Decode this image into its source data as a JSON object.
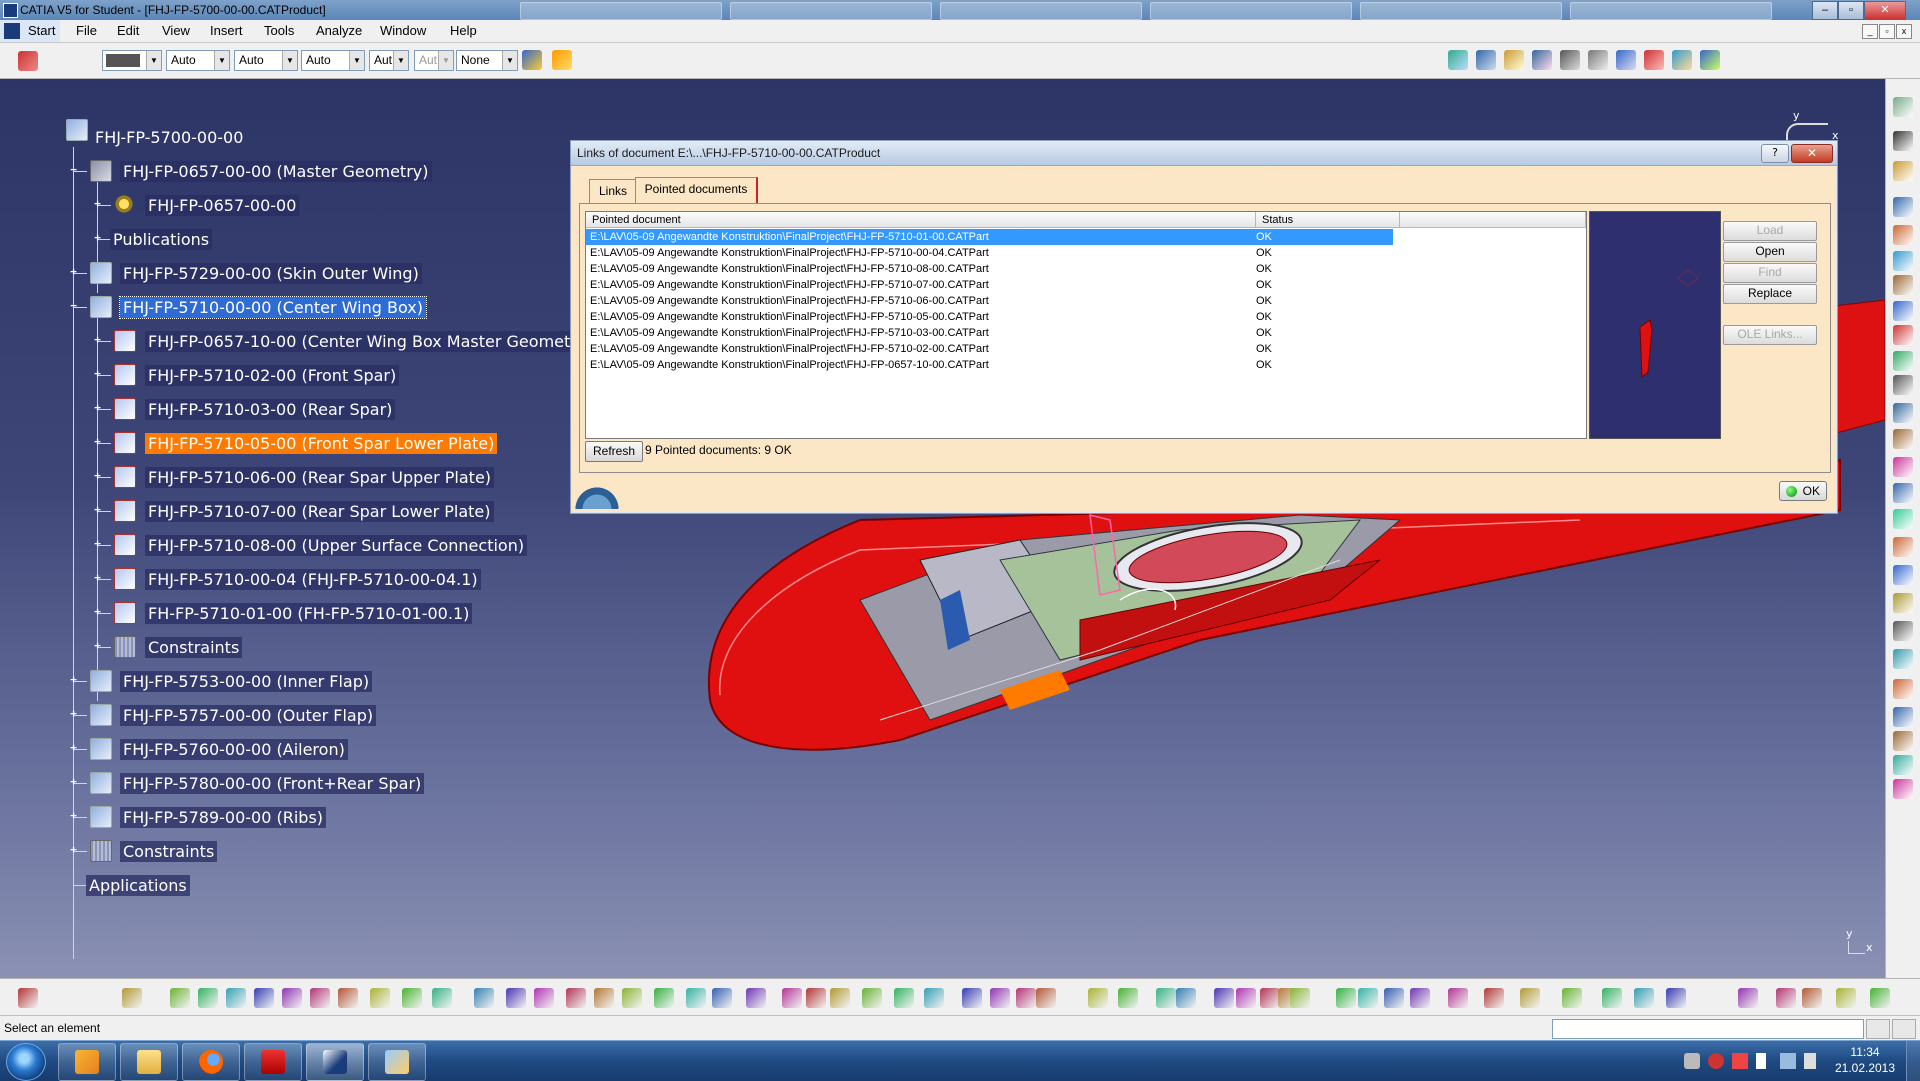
{
  "window": {
    "title": "CATIA V5 for Student - [FHJ-FP-5700-00-00.CATProduct]",
    "minimize": "–",
    "maximize": "▫",
    "close": "✕"
  },
  "menu": {
    "start": "Start",
    "items": [
      "File",
      "Edit",
      "View",
      "Insert",
      "Tools",
      "Analyze",
      "Window",
      "Help"
    ]
  },
  "toolbar": {
    "combos": [
      {
        "value": "",
        "disabled": false
      },
      {
        "value": "Auto",
        "disabled": false
      },
      {
        "value": "Auto",
        "disabled": false
      },
      {
        "value": "Auto",
        "disabled": false
      },
      {
        "value": "Aut",
        "disabled": false
      },
      {
        "value": "Aut",
        "disabled": true
      },
      {
        "value": "None",
        "disabled": false
      }
    ]
  },
  "tree": {
    "root": "FHJ-FP-5700-00-00",
    "nodes": [
      {
        "label": "FHJ-FP-0657-00-00 (Master Geometry)",
        "level": 1,
        "expanded": true,
        "icon": "geometry-icon"
      },
      {
        "label": "FHJ-FP-0657-00-00",
        "level": 2,
        "expanded": false,
        "icon": "part-gear-icon"
      },
      {
        "label": "Publications",
        "level": 2,
        "expanded": false,
        "icon": "none"
      },
      {
        "label": "FHJ-FP-5729-00-00 (Skin Outer Wing)",
        "level": 1,
        "expanded": false,
        "icon": "product-icon"
      },
      {
        "label": "FHJ-FP-5710-00-00 (Center Wing Box)",
        "level": 1,
        "expanded": true,
        "icon": "product-icon",
        "state": "selected-blue"
      },
      {
        "label": "FHJ-FP-0657-10-00 (Center Wing Box Master Geometry)",
        "level": 2,
        "expanded": false,
        "icon": "part-icon"
      },
      {
        "label": "FHJ-FP-5710-02-00 (Front Spar)",
        "level": 2,
        "expanded": false,
        "icon": "part-icon"
      },
      {
        "label": "FHJ-FP-5710-03-00 (Rear Spar)",
        "level": 2,
        "expanded": false,
        "icon": "part-icon"
      },
      {
        "label": "FHJ-FP-5710-05-00 (Front Spar Lower Plate)",
        "level": 2,
        "expanded": false,
        "icon": "part-icon",
        "state": "selected-orange"
      },
      {
        "label": "FHJ-FP-5710-06-00 (Rear Spar Upper Plate)",
        "level": 2,
        "expanded": false,
        "icon": "part-icon"
      },
      {
        "label": "FHJ-FP-5710-07-00 (Rear Spar Lower Plate)",
        "level": 2,
        "expanded": false,
        "icon": "part-icon"
      },
      {
        "label": "FHJ-FP-5710-08-00 (Upper Surface Connection)",
        "level": 2,
        "expanded": false,
        "icon": "part-icon"
      },
      {
        "label": "FHJ-FP-5710-00-04 (FHJ-FP-5710-00-04.1)",
        "level": 2,
        "expanded": false,
        "icon": "part-icon"
      },
      {
        "label": "FH-FP-5710-01-00 (FH-FP-5710-01-00.1)",
        "level": 2,
        "expanded": false,
        "icon": "part-icon"
      },
      {
        "label": "Constraints",
        "level": 2,
        "expanded": false,
        "icon": "constraint-icon"
      },
      {
        "label": "FHJ-FP-5753-00-00 (Inner Flap)",
        "level": 1,
        "expanded": false,
        "icon": "product-icon"
      },
      {
        "label": "FHJ-FP-5757-00-00 (Outer Flap)",
        "level": 1,
        "expanded": false,
        "icon": "product-icon"
      },
      {
        "label": "FHJ-FP-5760-00-00 (Aileron)",
        "level": 1,
        "expanded": false,
        "icon": "product-icon"
      },
      {
        "label": "FHJ-FP-5780-00-00 (Front+Rear Spar)",
        "level": 1,
        "expanded": false,
        "icon": "product-icon"
      },
      {
        "label": "FHJ-FP-5789-00-00 (Ribs)",
        "level": 1,
        "expanded": false,
        "icon": "product-icon"
      },
      {
        "label": "Constraints",
        "level": 1,
        "expanded": false,
        "icon": "constraint-icon"
      },
      {
        "label": "Applications",
        "level": 0,
        "expanded": false,
        "icon": "none"
      }
    ]
  },
  "dialog": {
    "title": "Links of document E:\\...\\FHJ-FP-5710-00-00.CATProduct",
    "help": "?",
    "close": "✕",
    "tabs": [
      "Links",
      "Pointed documents"
    ],
    "active_tab": "Pointed documents",
    "columns": [
      "Pointed document",
      "Status"
    ],
    "rows": [
      {
        "path": "E:\\LAV\\05-09 Angewandte Konstruktion\\FinalProject\\FHJ-FP-5710-01-00.CATPart",
        "status": "OK"
      },
      {
        "path": "E:\\LAV\\05-09 Angewandte Konstruktion\\FinalProject\\FHJ-FP-5710-00-04.CATPart",
        "status": "OK"
      },
      {
        "path": "E:\\LAV\\05-09 Angewandte Konstruktion\\FinalProject\\FHJ-FP-5710-08-00.CATPart",
        "status": "OK"
      },
      {
        "path": "E:\\LAV\\05-09 Angewandte Konstruktion\\FinalProject\\FHJ-FP-5710-07-00.CATPart",
        "status": "OK"
      },
      {
        "path": "E:\\LAV\\05-09 Angewandte Konstruktion\\FinalProject\\FHJ-FP-5710-06-00.CATPart",
        "status": "OK"
      },
      {
        "path": "E:\\LAV\\05-09 Angewandte Konstruktion\\FinalProject\\FHJ-FP-5710-05-00.CATPart",
        "status": "OK"
      },
      {
        "path": "E:\\LAV\\05-09 Angewandte Konstruktion\\FinalProject\\FHJ-FP-5710-03-00.CATPart",
        "status": "OK"
      },
      {
        "path": "E:\\LAV\\05-09 Angewandte Konstruktion\\FinalProject\\FHJ-FP-5710-02-00.CATPart",
        "status": "OK"
      },
      {
        "path": "E:\\LAV\\05-09 Angewandte Konstruktion\\FinalProject\\FHJ-FP-0657-10-00.CATPart",
        "status": "OK"
      }
    ],
    "selected_row": 0,
    "buttons": [
      {
        "label": "Load",
        "disabled": true
      },
      {
        "label": "Open",
        "disabled": false
      },
      {
        "label": "Find",
        "disabled": true
      },
      {
        "label": "Replace",
        "disabled": false
      },
      {
        "label": "OLE Links...",
        "disabled": true
      }
    ],
    "refresh": "Refresh",
    "summary": "9 Pointed documents: 9 OK",
    "ok": "OK"
  },
  "viewport": {
    "compass_y": "y",
    "compass_x": "x",
    "axis_y": "y",
    "axis_x": "x"
  },
  "status": {
    "text": "Select an element"
  },
  "taskbar": {
    "time": "11:34",
    "date": "21.02.2013"
  },
  "colors": {
    "selection_blue": "#2e6bd2",
    "selection_orange": "#ff7b00",
    "wing_red": "#e01010",
    "dialog_bg": "#fbe6c6"
  }
}
